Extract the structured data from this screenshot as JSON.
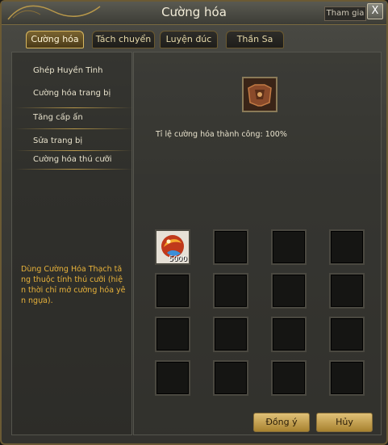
{
  "window": {
    "title": "Cường hóa",
    "ext_tab": "Tham gia",
    "close": "X"
  },
  "tabs": [
    {
      "label": "Cường hóa",
      "active": true
    },
    {
      "label": "Tách chuyển",
      "active": false
    },
    {
      "label": "Luyện đúc",
      "active": false
    },
    {
      "label": "Thần Sa",
      "active": false
    }
  ],
  "menu": [
    {
      "label": "Ghép Huyền Tinh"
    },
    {
      "label": "Cường hóa trang bị"
    },
    {
      "label": "Tăng cấp ấn"
    },
    {
      "label": "Sửa trang bị"
    },
    {
      "label": "Cường hóa thú cưỡi"
    }
  ],
  "description": "Dùng Cường Hóa Thạch tăng thuộc tính thú cưỡi (hiện thời chỉ mở cường hóa yên ngựa).",
  "success_rate": "Tỉ lệ cường hóa thành công: 100%",
  "material_slots": [
    {
      "item": "crystal",
      "qty": "5000"
    },
    {},
    {},
    {},
    {},
    {},
    {},
    {},
    {},
    {},
    {},
    {},
    {},
    {},
    {},
    {}
  ],
  "buttons": {
    "confirm": "Đồng ý",
    "cancel": "Hủy"
  }
}
